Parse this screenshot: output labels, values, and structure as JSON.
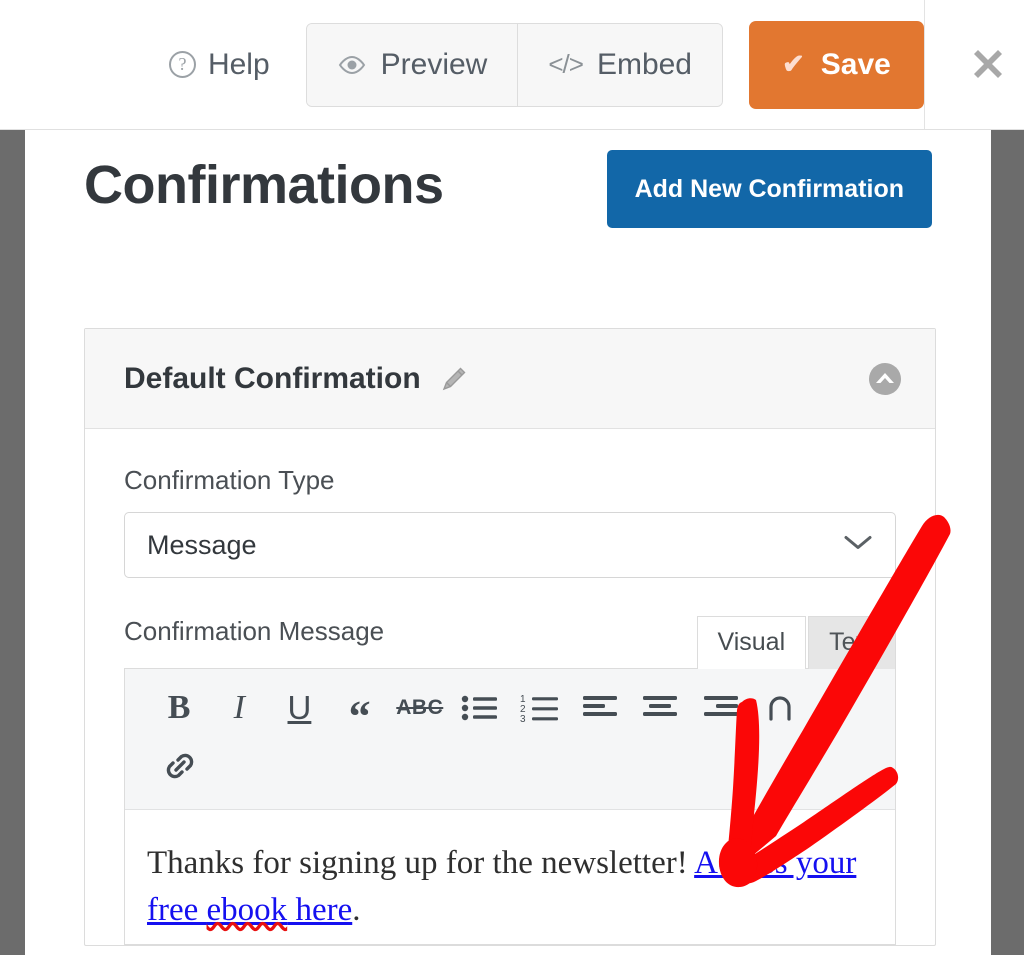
{
  "topbar": {
    "help_label": "Help",
    "help_icon": "question-circle-icon",
    "preview_label": "Preview",
    "preview_icon": "eye-icon",
    "embed_label": "Embed",
    "embed_icon": "code-brackets-icon",
    "embed_glyph": "</>",
    "save_label": "Save",
    "save_icon": "check-icon",
    "save_glyph": "✔",
    "close_icon": "close-x-icon",
    "colors": {
      "save_bg": "#e27730",
      "segment_bg": "#f7f7f7",
      "text": "#555d66"
    }
  },
  "page": {
    "title": "Confirmations",
    "add_button_label": "Add New Confirmation",
    "add_button_color": "#1267a8"
  },
  "panel": {
    "title": "Default Confirmation",
    "edit_icon": "pencil-icon",
    "collapse_icon": "chevron-up-circle-icon",
    "fields": {
      "type_label": "Confirmation Type",
      "type_value": "Message",
      "type_caret_icon": "chevron-down-icon",
      "message_label": "Confirmation Message"
    },
    "tabs": [
      {
        "label": "Visual",
        "active": true
      },
      {
        "label": "Text",
        "active": false
      }
    ],
    "toolbar": {
      "row1": [
        {
          "name": "bold-icon",
          "glyph": "B",
          "cls": "tb-b"
        },
        {
          "name": "italic-icon",
          "glyph": "I",
          "cls": "tb-i"
        },
        {
          "name": "underline-icon",
          "glyph": "U",
          "cls": "tb-u"
        },
        {
          "name": "blockquote-icon",
          "glyph": "“",
          "cls": "tb-q"
        },
        {
          "name": "strikethrough-icon",
          "glyph": "ABC",
          "cls": "tb-s"
        },
        {
          "name": "bulleted-list-icon",
          "glyph": "",
          "cls": "tb-svg"
        },
        {
          "name": "numbered-list-icon",
          "glyph": "",
          "cls": "tb-svg"
        },
        {
          "name": "align-left-icon",
          "glyph": "",
          "cls": "tb-svg"
        },
        {
          "name": "align-center-icon",
          "glyph": "",
          "cls": "tb-svg"
        },
        {
          "name": "align-right-icon",
          "glyph": "",
          "cls": "tb-svg"
        },
        {
          "name": "undo-icon",
          "glyph": "",
          "cls": "tb-svg"
        },
        {
          "name": "redo-icon",
          "glyph": "",
          "cls": "tb-svg"
        }
      ],
      "row2": [
        {
          "name": "insert-link-icon",
          "glyph": "",
          "cls": "tb-svg"
        }
      ]
    },
    "message": {
      "text_before": "Thanks for signing up for the newsletter! ",
      "link_part1": "Access your free ",
      "link_misspelled_word": "ebook",
      "link_part2": " here",
      "text_after": ".",
      "link_color": "#1510f0",
      "misspell_underline_color": "#e81010"
    }
  },
  "annotation": {
    "type": "arrow",
    "color": "#fb0707",
    "description": "red hand-drawn arrow pointing down-left toward the confirmation message link"
  }
}
